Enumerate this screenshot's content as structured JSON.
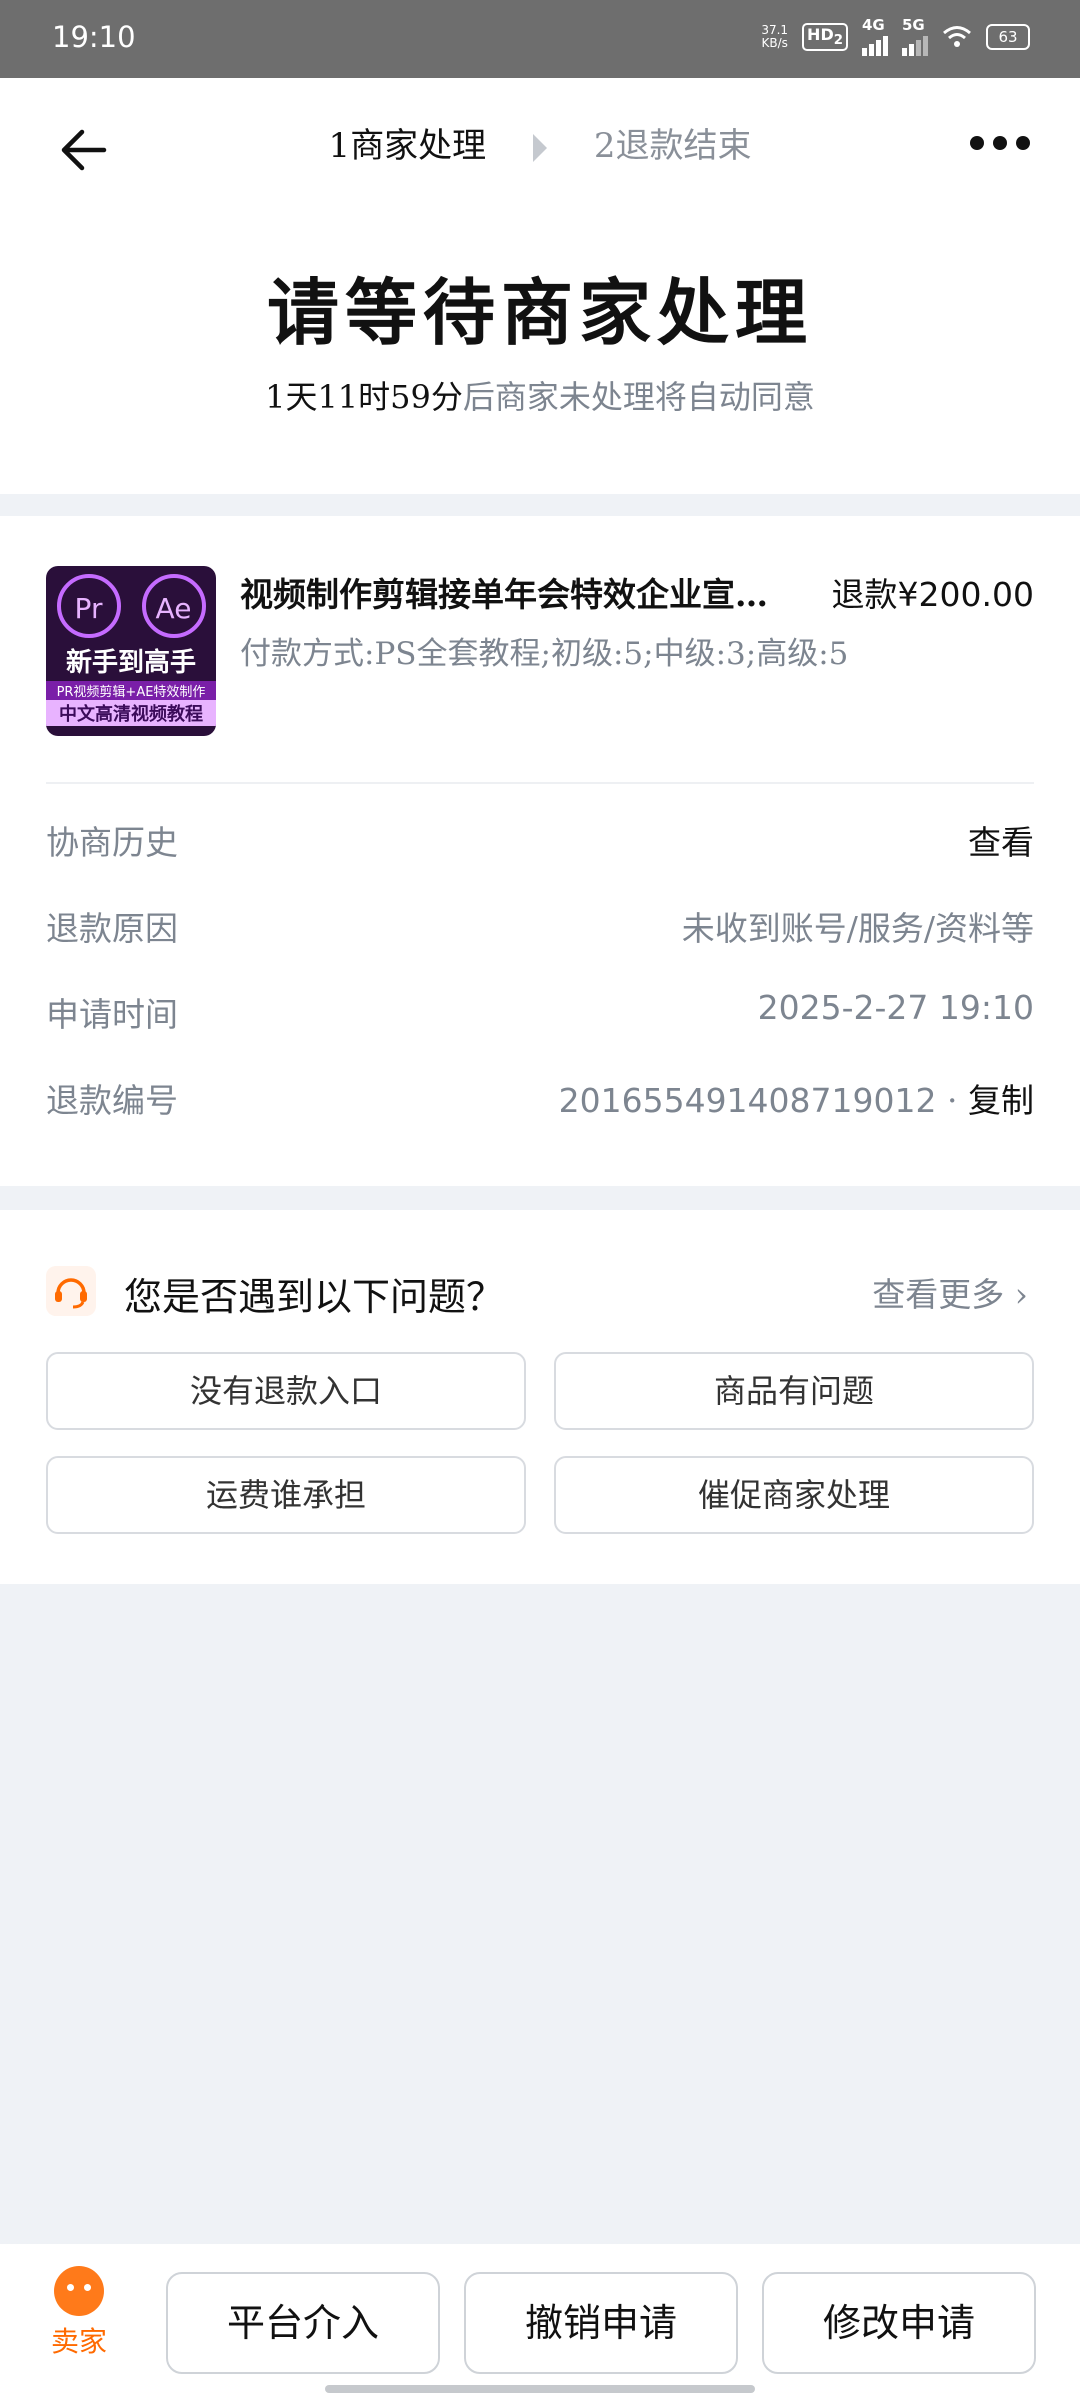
{
  "status_bar": {
    "time": "19:10",
    "net_speed": "37.1",
    "net_unit": "KB/s",
    "hd_label": "HD",
    "hd_sub": "2",
    "sig1_label": "4G",
    "sig2_label": "5G",
    "battery": "63"
  },
  "header": {
    "step1_num": "1",
    "step1_label": "商家处理",
    "step2_num": "2",
    "step2_label": "退款结束",
    "title": "请等待商家处理",
    "countdown": "1天11时59分",
    "countdown_suffix": "后商家未处理将自动同意"
  },
  "product": {
    "thumb_logo1": "Pr",
    "thumb_logo2": "Ae",
    "thumb_line1": "新手到高手",
    "thumb_line2": "PR视频剪辑+AE特效制作",
    "thumb_line3": "中文高清视频教程",
    "name": "视频制作剪辑接单年会特效企业宣传片",
    "refund": "退款¥200.00",
    "payment": "付款方式:PS全套教程;初级:5;中级:3;高级:5"
  },
  "details": [
    {
      "key": "协商历史",
      "value": "查看"
    },
    {
      "key": "退款原因",
      "value": "未收到账号/服务/资料等"
    },
    {
      "key": "申请时间",
      "value": "2025-2-27 19:10"
    },
    {
      "key": "退款编号",
      "value": "201655491408719012",
      "copy_label": "复制"
    }
  ],
  "help": {
    "question": "您是否遇到以下问题？",
    "see_more": "查看更多",
    "options": [
      "没有退款入口",
      "商品有问题",
      "运费谁承担",
      "催促商家处理"
    ]
  },
  "bottom": {
    "seller_label": "卖家",
    "buttons": [
      "平台介入",
      "撤销申请",
      "修改申请"
    ]
  },
  "colors": {
    "accent": "#ff6a00",
    "muted_text": "#7d8590",
    "page_bg": "#eff2f6"
  }
}
